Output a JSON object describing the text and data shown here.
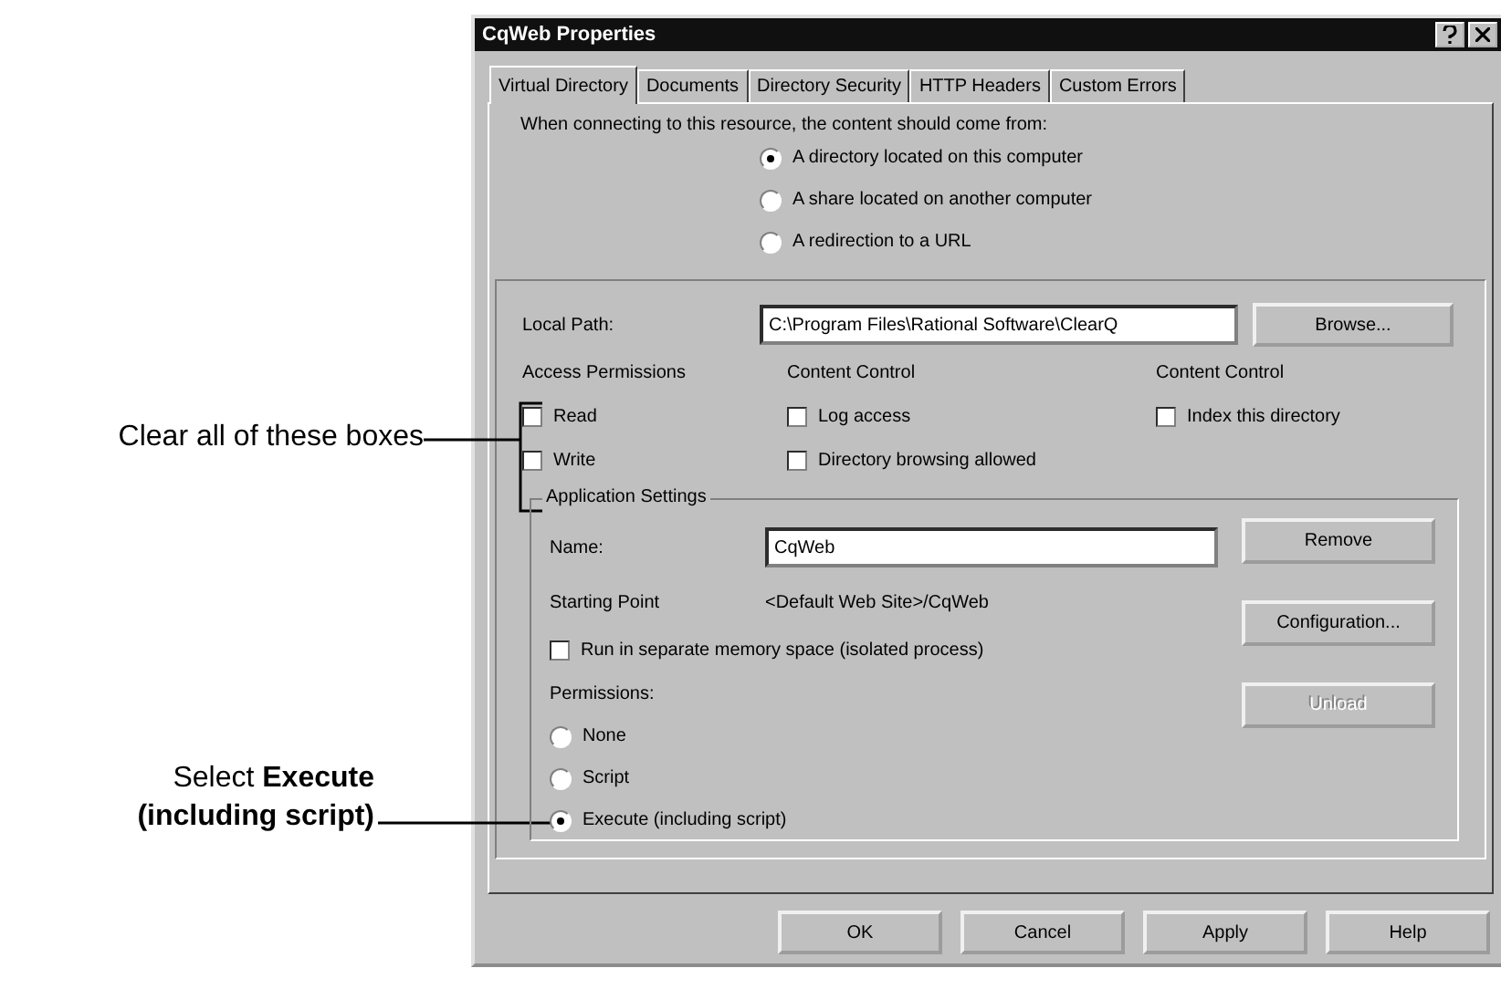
{
  "window": {
    "title": "CqWeb Properties"
  },
  "tabs": [
    {
      "label": "Virtual Directory",
      "selected": true
    },
    {
      "label": "Documents",
      "selected": false
    },
    {
      "label": "Directory Security",
      "selected": false
    },
    {
      "label": "HTTP Headers",
      "selected": false
    },
    {
      "label": "Custom Errors",
      "selected": false
    }
  ],
  "source_prompt": "When connecting to this resource, the content should come from:",
  "source_options": [
    {
      "label": "A directory located on this computer",
      "selected": true
    },
    {
      "label": "A share located on another computer",
      "selected": false
    },
    {
      "label": "A redirection to a URL",
      "selected": false
    }
  ],
  "local_path": {
    "label": "Local Path:",
    "value": "C:\\Program Files\\Rational Software\\ClearQ",
    "button": "Browse..."
  },
  "check_groups": [
    {
      "heading": "Access Permissions",
      "items": [
        {
          "label": "Read",
          "checked": false
        },
        {
          "label": "Write",
          "checked": false
        }
      ]
    },
    {
      "heading": "Content Control",
      "items": [
        {
          "label": "Log access",
          "checked": false
        },
        {
          "label": "Directory browsing allowed",
          "checked": false
        }
      ]
    },
    {
      "heading": "Content Control",
      "items": [
        {
          "label": "Index this directory",
          "checked": false
        }
      ]
    }
  ],
  "app_settings": {
    "title": "Application Settings",
    "name_label": "Name:",
    "name_value": "CqWeb",
    "start_label": "Starting Point",
    "start_value": "<Default Web Site>/CqWeb",
    "isolated": {
      "label": "Run in separate memory space (isolated process)",
      "checked": false
    },
    "permissions_label": "Permissions:",
    "permissions": [
      {
        "label": "None",
        "selected": false
      },
      {
        "label": "Script",
        "selected": false
      },
      {
        "label": "Execute (including script)",
        "selected": true
      }
    ],
    "buttons": [
      {
        "label": "Remove",
        "disabled": false
      },
      {
        "label": "Configuration...",
        "disabled": false
      },
      {
        "label": "Unload",
        "disabled": true
      }
    ]
  },
  "dialog_buttons": [
    "OK",
    "Cancel",
    "Apply",
    "Help"
  ],
  "callouts": [
    {
      "text": "Clear all of these boxes"
    },
    {
      "text": "Select **Execute** **(including script)**"
    }
  ]
}
